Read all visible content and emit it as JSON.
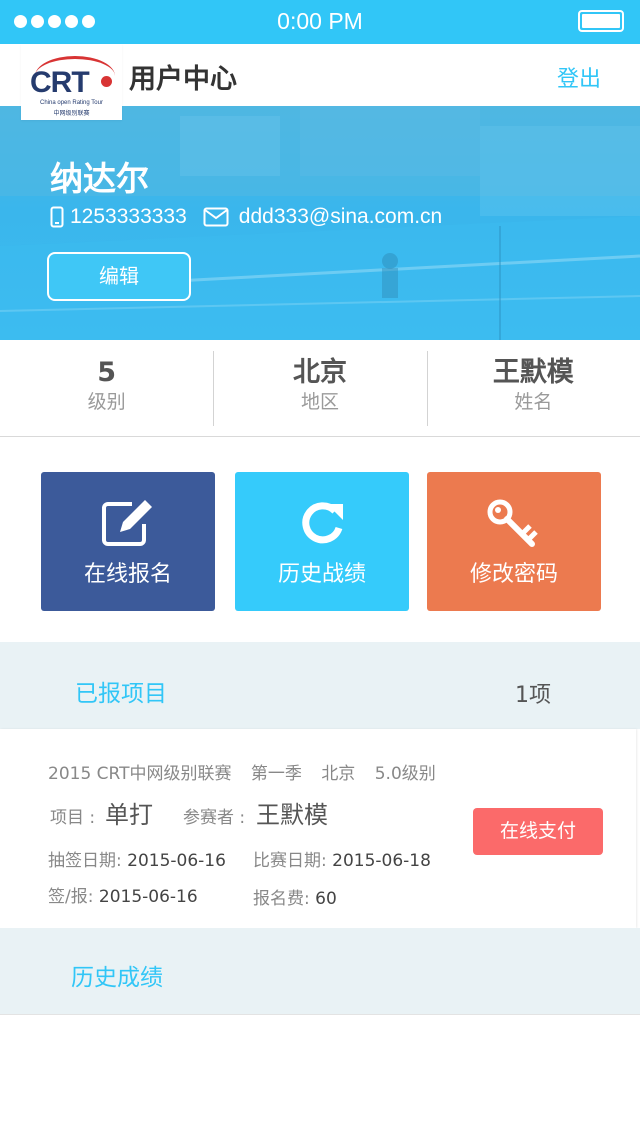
{
  "status_bar": {
    "time": "0:00 PM"
  },
  "logo": {
    "text": "CRT",
    "subtitle": "China open Rating Tour",
    "subtitle_cn": "中网级别联赛"
  },
  "header": {
    "title": "用户中心",
    "logout_label": "登出"
  },
  "profile": {
    "name": "纳达尔",
    "phone": "1253333333",
    "email": "ddd333@sina.com.cn",
    "edit_label": "编辑"
  },
  "info": [
    {
      "value": "5",
      "label": "级别"
    },
    {
      "value": "北京",
      "label": "地区"
    },
    {
      "value": "王默模",
      "label": "姓名"
    }
  ],
  "actions": [
    {
      "label": "在线报名",
      "icon": "edit-icon",
      "color": "#3c5a9a"
    },
    {
      "label": "历史战绩",
      "icon": "refresh-icon",
      "color": "#35cbfb"
    },
    {
      "label": "修改密码",
      "icon": "key-icon",
      "color": "#ec7a4f"
    }
  ],
  "registered": {
    "title": "已报项目",
    "count": "1项",
    "card": {
      "event": "2015 CRT中网级别联赛",
      "season": "第一季",
      "city": "北京",
      "level": "5.0级别",
      "item_label": "项目 :",
      "item_value": "单打",
      "player_label": "参赛者 :",
      "player_value": "王默模",
      "draw_date_label": "抽签日期:",
      "draw_date": "2015-06-16",
      "match_date_label": "比赛日期:",
      "match_date": "2015-06-18",
      "sign_label": "签/报:",
      "sign_date": "2015-06-16",
      "fee_label": "报名费:",
      "fee": "60",
      "pay_label": "在线支付"
    }
  },
  "history": {
    "title": "历史成绩"
  },
  "colors": {
    "accent": "#31c6f7",
    "pay": "#fb6a6a"
  }
}
